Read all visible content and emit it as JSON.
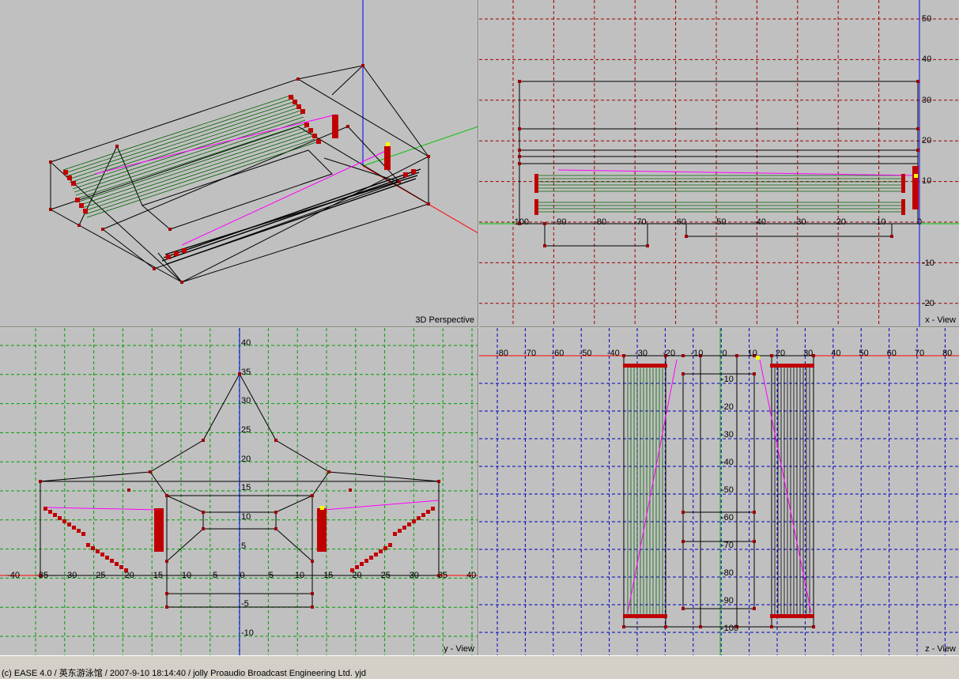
{
  "viewports": {
    "perspective": {
      "label": "3D Perspective"
    },
    "x_view": {
      "label": "x - View",
      "grid_color": "#a00000",
      "h_ticks": [
        "-100",
        "-90",
        "-80",
        "-70",
        "-60",
        "-50",
        "-40",
        "-30",
        "-20",
        "-10",
        "0"
      ],
      "v_ticks": [
        "50",
        "40",
        "30",
        "20",
        "10",
        "-10",
        "-20"
      ]
    },
    "y_view": {
      "label": "y - View",
      "grid_color": "#00a000",
      "h_ticks": [
        "-40",
        "-35",
        "-30",
        "-25",
        "-20",
        "-15",
        "-10",
        "-5",
        "0",
        "5",
        "10",
        "15",
        "20",
        "25",
        "30",
        "35",
        "40"
      ],
      "v_ticks": [
        "40",
        "35",
        "30",
        "25",
        "20",
        "15",
        "10",
        "5",
        "-5",
        "-10"
      ]
    },
    "z_view": {
      "label": "z - View",
      "grid_color": "#0000c0",
      "h_ticks": [
        "-80",
        "-70",
        "-60",
        "-50",
        "-40",
        "-30",
        "-20",
        "-10",
        "0",
        "10",
        "20",
        "30",
        "40",
        "50",
        "60",
        "70",
        "80"
      ],
      "v_ticks": [
        "-10",
        "-20",
        "-30",
        "-40",
        "-50",
        "-60",
        "-70",
        "-80",
        "-90",
        "-100"
      ]
    }
  },
  "status_bar": {
    "text": "(c) EASE 4.0  / 英东游泳馆  / 2007-9-10 18:14:40 / jolly Proaudio Broadcast Engineering Ltd. yjd"
  },
  "colors": {
    "background": "#c0c0c0",
    "vertex": "#b00000",
    "speaker_line": "#ff00ff",
    "listener": "#ffff00",
    "axis_x": "#ff0000",
    "axis_y": "#00c000",
    "axis_z": "#0000ff"
  }
}
